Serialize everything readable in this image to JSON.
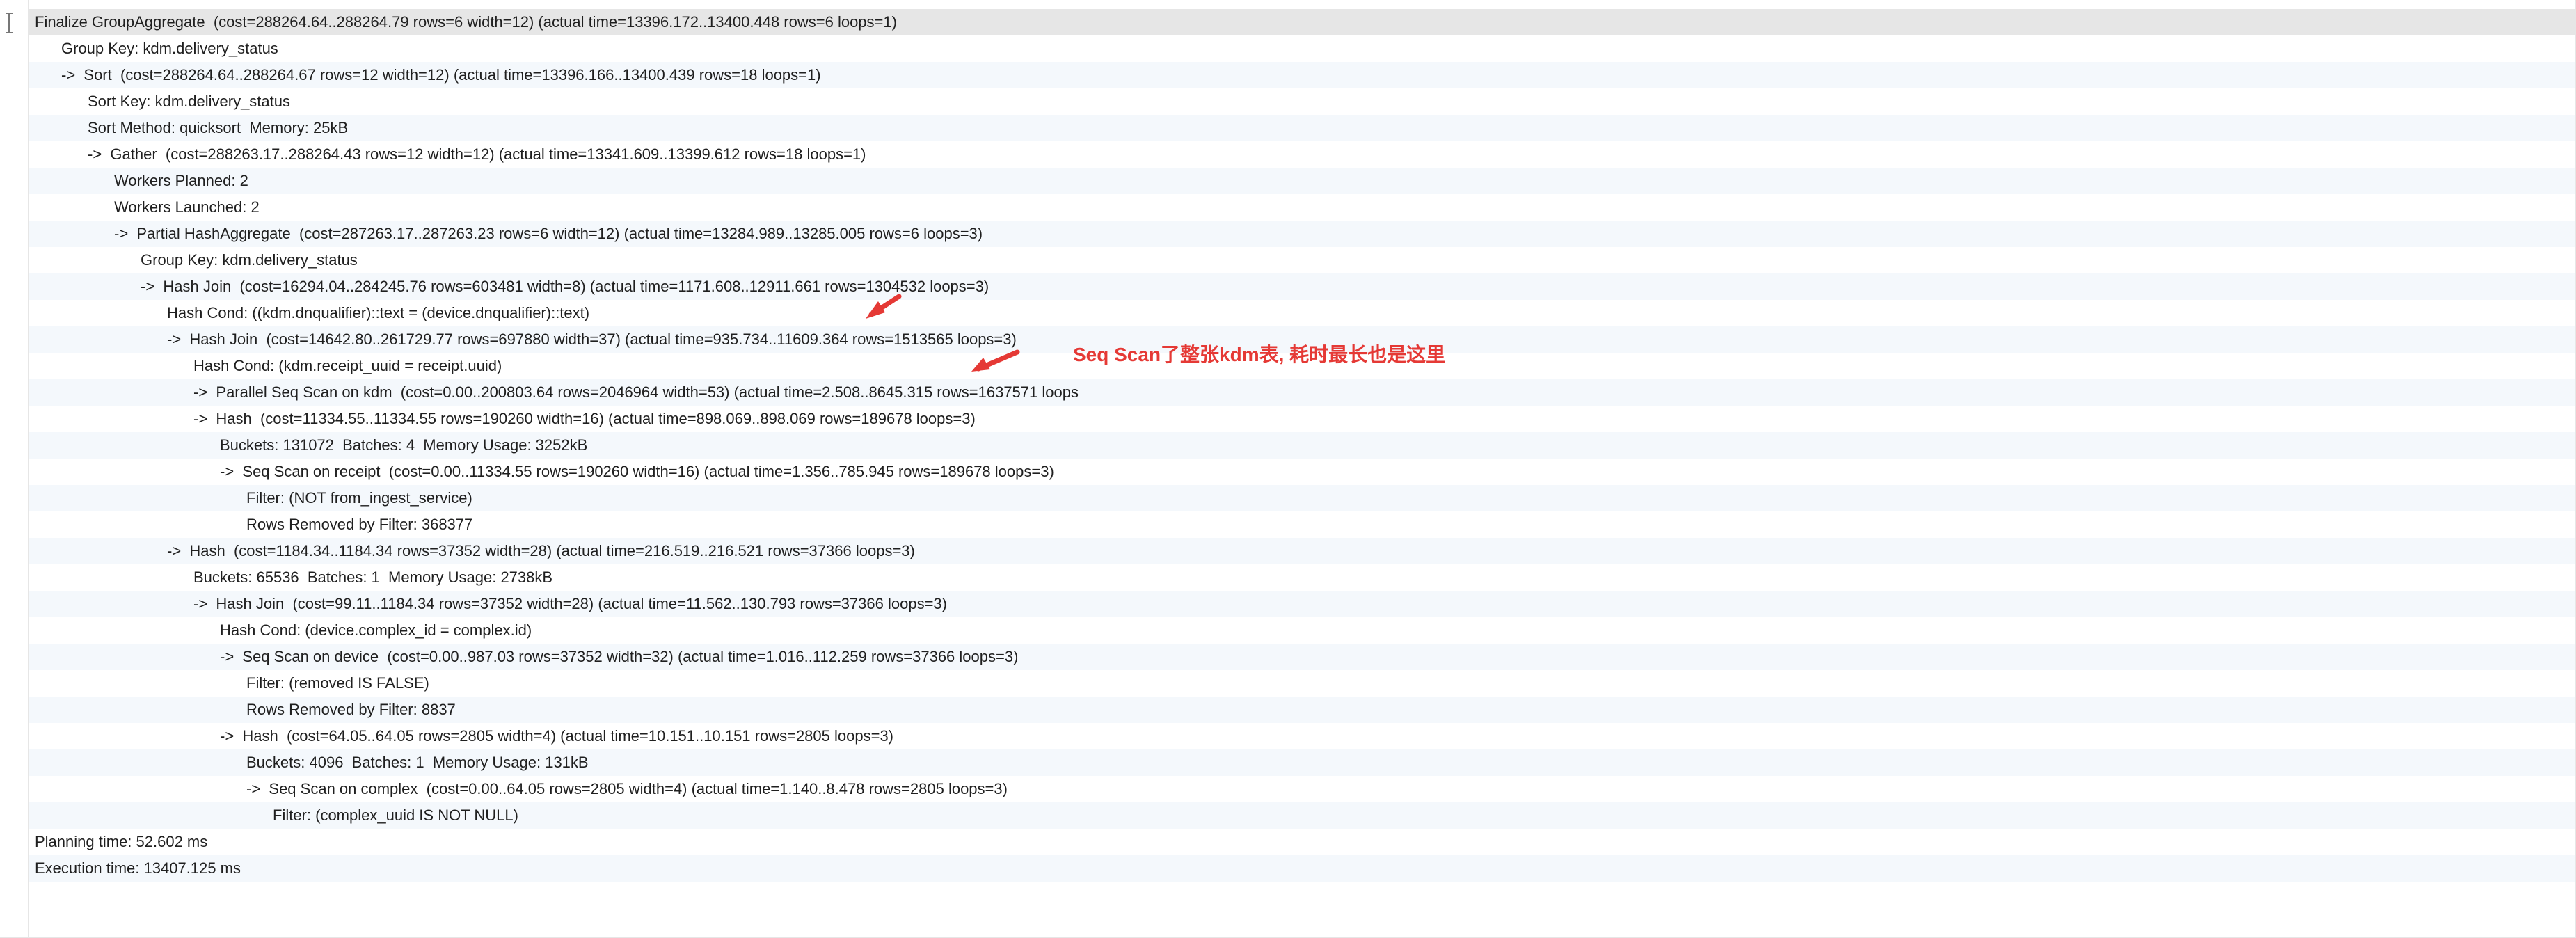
{
  "plan_lines": [
    {
      "indent": 0,
      "text": "Finalize GroupAggregate  (cost=288264.64..288264.79 rows=6 width=12) (actual time=13396.172..13400.448 rows=6 loops=1)"
    },
    {
      "indent": 1,
      "text": "Group Key: kdm.delivery_status"
    },
    {
      "indent": 1,
      "text": "->  Sort  (cost=288264.64..288264.67 rows=12 width=12) (actual time=13396.166..13400.439 rows=18 loops=1)"
    },
    {
      "indent": 2,
      "text": "Sort Key: kdm.delivery_status"
    },
    {
      "indent": 2,
      "text": "Sort Method: quicksort  Memory: 25kB"
    },
    {
      "indent": 2,
      "text": "->  Gather  (cost=288263.17..288264.43 rows=12 width=12) (actual time=13341.609..13399.612 rows=18 loops=1)"
    },
    {
      "indent": 3,
      "text": "Workers Planned: 2"
    },
    {
      "indent": 3,
      "text": "Workers Launched: 2"
    },
    {
      "indent": 3,
      "text": "->  Partial HashAggregate  (cost=287263.17..287263.23 rows=6 width=12) (actual time=13284.989..13285.005 rows=6 loops=3)"
    },
    {
      "indent": 4,
      "text": "Group Key: kdm.delivery_status"
    },
    {
      "indent": 4,
      "text": "->  Hash Join  (cost=16294.04..284245.76 rows=603481 width=8) (actual time=1171.608..12911.661 rows=1304532 loops=3)"
    },
    {
      "indent": 5,
      "text": "Hash Cond: ((kdm.dnqualifier)::text = (device.dnqualifier)::text)"
    },
    {
      "indent": 5,
      "text": "->  Hash Join  (cost=14642.80..261729.77 rows=697880 width=37) (actual time=935.734..11609.364 rows=1513565 loops=3)"
    },
    {
      "indent": 6,
      "text": "Hash Cond: (kdm.receipt_uuid = receipt.uuid)"
    },
    {
      "indent": 6,
      "text": "->  Parallel Seq Scan on kdm  (cost=0.00..200803.64 rows=2046964 width=53) (actual time=2.508..8645.315 rows=1637571 loops"
    },
    {
      "indent": 6,
      "text": "->  Hash  (cost=11334.55..11334.55 rows=190260 width=16) (actual time=898.069..898.069 rows=189678 loops=3)"
    },
    {
      "indent": 7,
      "text": "Buckets: 131072  Batches: 4  Memory Usage: 3252kB"
    },
    {
      "indent": 7,
      "text": "->  Seq Scan on receipt  (cost=0.00..11334.55 rows=190260 width=16) (actual time=1.356..785.945 rows=189678 loops=3)"
    },
    {
      "indent": 8,
      "text": "Filter: (NOT from_ingest_service)"
    },
    {
      "indent": 8,
      "text": "Rows Removed by Filter: 368377"
    },
    {
      "indent": 5,
      "text": "->  Hash  (cost=1184.34..1184.34 rows=37352 width=28) (actual time=216.519..216.521 rows=37366 loops=3)"
    },
    {
      "indent": 6,
      "text": "Buckets: 65536  Batches: 1  Memory Usage: 2738kB"
    },
    {
      "indent": 6,
      "text": "->  Hash Join  (cost=99.11..1184.34 rows=37352 width=28) (actual time=11.562..130.793 rows=37366 loops=3)"
    },
    {
      "indent": 7,
      "text": "Hash Cond: (device.complex_id = complex.id)"
    },
    {
      "indent": 7,
      "text": "->  Seq Scan on device  (cost=0.00..987.03 rows=37352 width=32) (actual time=1.016..112.259 rows=37366 loops=3)"
    },
    {
      "indent": 8,
      "text": "Filter: (removed IS FALSE)"
    },
    {
      "indent": 8,
      "text": "Rows Removed by Filter: 8837"
    },
    {
      "indent": 7,
      "text": "->  Hash  (cost=64.05..64.05 rows=2805 width=4) (actual time=10.151..10.151 rows=2805 loops=3)"
    },
    {
      "indent": 8,
      "text": "Buckets: 4096  Batches: 1  Memory Usage: 131kB"
    },
    {
      "indent": 8,
      "text": "->  Seq Scan on complex  (cost=0.00..64.05 rows=2805 width=4) (actual time=1.140..8.478 rows=2805 loops=3)"
    },
    {
      "indent": 9,
      "text": "Filter: (complex_uuid IS NOT NULL)"
    },
    {
      "indent": 0,
      "text": "Planning time: 52.602 ms"
    },
    {
      "indent": 0,
      "text": "Execution time: 13407.125 ms"
    }
  ],
  "annotation": {
    "text": "Seq Scan了整张kdm表, 耗时最长也是这里",
    "color": "#e53935"
  },
  "colors": {
    "first_row_bg": "#e6e6e6",
    "alt_row_bg": "#f4f8fc",
    "text": "#1f1f1f"
  }
}
